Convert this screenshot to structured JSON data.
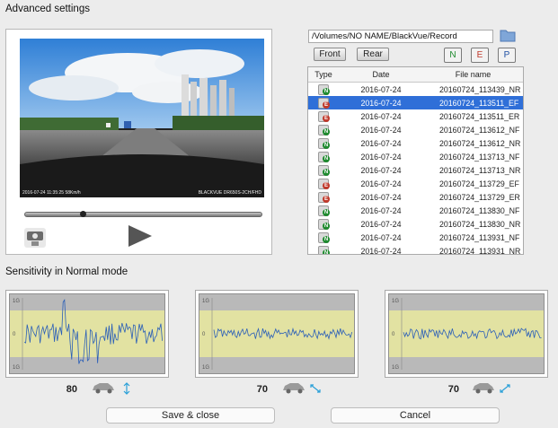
{
  "window": {
    "section_title": "Advanced settings"
  },
  "player": {
    "overlay_left": "2016-07-24  11:35:25     58Km/h",
    "overlay_right": "BLACKVUE DR650S-2CH/FHD",
    "seek_progress": 0.24,
    "snapshot_icon": "camera-snapshot-icon",
    "play_icon": "play-icon"
  },
  "browser": {
    "path": "/Volumes/NO NAME/BlackVue/Record",
    "folder_icon": "folder-icon",
    "tabs": [
      "Front",
      "Rear"
    ],
    "filters": [
      "N",
      "E",
      "P"
    ],
    "filter_colors": {
      "N": "#1e8a2e",
      "E": "#c0392b",
      "P": "#1f4fa3"
    }
  },
  "file_table": {
    "columns": [
      "Type",
      "Date",
      "File name"
    ],
    "rows": [
      {
        "type": "N",
        "date": "2016-07-24",
        "name": "20160724_113439_NR"
      },
      {
        "type": "E",
        "date": "2016-07-24",
        "name": "20160724_113511_EF",
        "selected": true
      },
      {
        "type": "E",
        "date": "2016-07-24",
        "name": "20160724_113511_ER"
      },
      {
        "type": "N",
        "date": "2016-07-24",
        "name": "20160724_113612_NF"
      },
      {
        "type": "N",
        "date": "2016-07-24",
        "name": "20160724_113612_NR"
      },
      {
        "type": "N",
        "date": "2016-07-24",
        "name": "20160724_113713_NF"
      },
      {
        "type": "N",
        "date": "2016-07-24",
        "name": "20160724_113713_NR"
      },
      {
        "type": "E",
        "date": "2016-07-24",
        "name": "20160724_113729_EF"
      },
      {
        "type": "E",
        "date": "2016-07-24",
        "name": "20160724_113729_ER"
      },
      {
        "type": "N",
        "date": "2016-07-24",
        "name": "20160724_113830_NF"
      },
      {
        "type": "N",
        "date": "2016-07-24",
        "name": "20160724_113830_NR"
      },
      {
        "type": "N",
        "date": "2016-07-24",
        "name": "20160724_113931_NF"
      },
      {
        "type": "N",
        "date": "2016-07-24",
        "name": "20160724_113931_NR"
      }
    ]
  },
  "sensitivity": {
    "title": "Sensitivity in Normal mode",
    "graph_labels": {
      "top": "1G",
      "mid": "0",
      "bottom": "1G"
    },
    "axes": [
      {
        "value": "80",
        "axis_icon": "vertical-axis-icon"
      },
      {
        "value": "70",
        "axis_icon": "front-back-axis-icon"
      },
      {
        "value": "70",
        "axis_icon": "left-right-axis-icon"
      }
    ]
  },
  "footer": {
    "save_label": "Save & close",
    "cancel_label": "Cancel"
  }
}
